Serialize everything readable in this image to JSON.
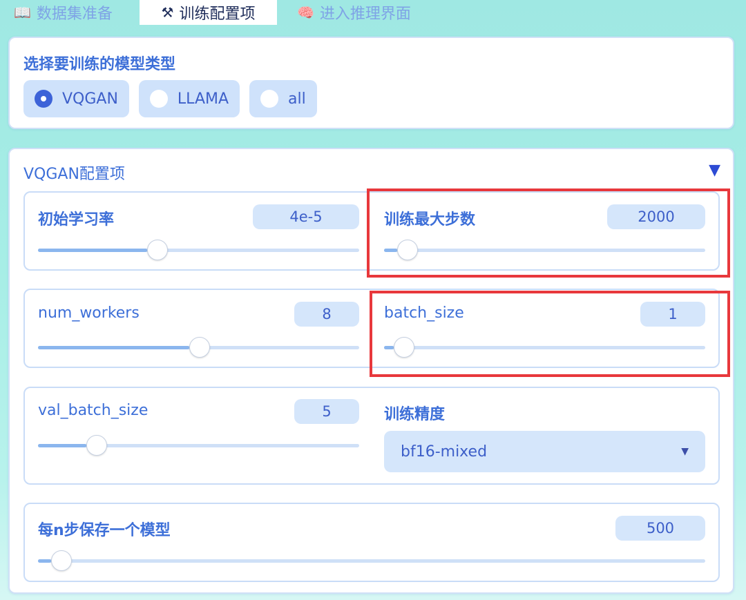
{
  "tabs": [
    {
      "icon": "📖",
      "label": "数据集准备"
    },
    {
      "icon": "⚒",
      "label": "训练配置项"
    },
    {
      "icon": "🧠",
      "label": "进入推理界面"
    }
  ],
  "model_select": {
    "label": "选择要训练的模型类型",
    "options": [
      "VQGAN",
      "LLAMA",
      "all"
    ],
    "selected": "VQGAN"
  },
  "vqgan": {
    "title": "VQGAN配置项",
    "collapse_arrow": "▼",
    "learning_rate": {
      "label": "初始学习率",
      "value": "4e-5",
      "level": 0.34
    },
    "max_steps": {
      "label": "训练最大步数",
      "value": "2000",
      "level": 0.04
    },
    "num_workers": {
      "label": "num_workers",
      "value": "8",
      "level": 0.47
    },
    "batch_size": {
      "label": "batch_size",
      "value": "1",
      "level": 0.03
    },
    "val_batch_size": {
      "label": "val_batch_size",
      "value": "5",
      "level": 0.15
    },
    "precision": {
      "label": "训练精度",
      "value": "bf16-mixed"
    },
    "save_every": {
      "label": "每n步保存一个模型",
      "value": "500",
      "level": 0.02
    }
  },
  "colors": {
    "accent": "#3d63d8",
    "highlight": "#e8383c",
    "background": "#a7eee6"
  }
}
